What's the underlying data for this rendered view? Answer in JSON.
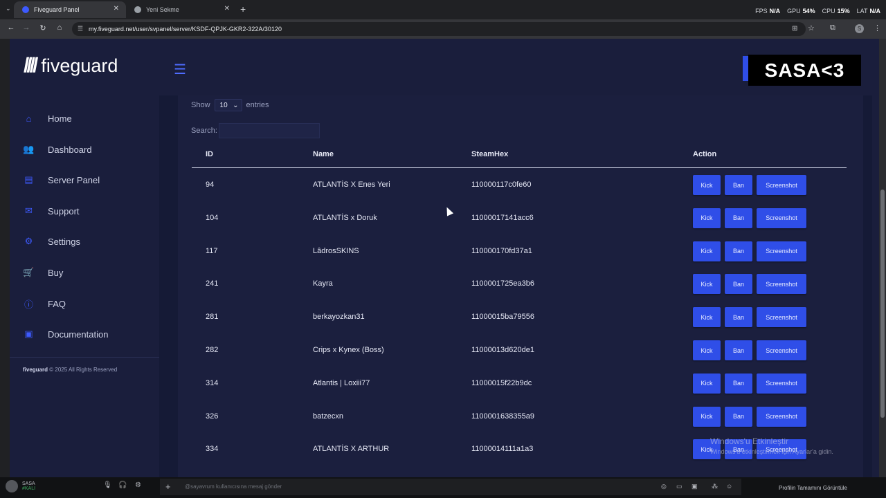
{
  "browser": {
    "tabs": [
      {
        "title": "Fiveguard Panel",
        "active": true
      },
      {
        "title": "Yeni Sekme",
        "active": false
      }
    ],
    "url": "my.fiveguard.net/user/svpanel/server/KSDF-QPJK-GKR2-322A/30120",
    "perf": [
      {
        "label": "FPS",
        "value": "N/A"
      },
      {
        "label": "GPU",
        "value": "54%"
      },
      {
        "label": "CPU",
        "value": "15%"
      },
      {
        "label": "LAT",
        "value": "N/A"
      }
    ],
    "profile_initial": "S"
  },
  "brand": {
    "name": "fiveguard",
    "mark": "////"
  },
  "overlay_label": "SASA<3",
  "sidebar": {
    "items": [
      {
        "label": "Home",
        "icon": "home-icon",
        "glyph": "⌂"
      },
      {
        "label": "Dashboard",
        "icon": "users-icon",
        "glyph": "👥"
      },
      {
        "label": "Server Panel",
        "icon": "server-icon",
        "glyph": "▤"
      },
      {
        "label": "Support",
        "icon": "mail-icon",
        "glyph": "✉"
      },
      {
        "label": "Settings",
        "icon": "gear-icon",
        "glyph": "⚙"
      },
      {
        "label": "Buy",
        "icon": "cart-icon",
        "glyph": "🛒"
      },
      {
        "label": "FAQ",
        "icon": "info-icon",
        "glyph": "ⓘ"
      },
      {
        "label": "Documentation",
        "icon": "document-icon",
        "glyph": "▣"
      }
    ],
    "footer_brand": "fiveguard",
    "footer_text": "© 2025 All Rights Reserved"
  },
  "table_controls": {
    "show_label": "Show",
    "entries_value": "10",
    "entries_label": "entries",
    "search_label": "Search:"
  },
  "table": {
    "columns": [
      "ID",
      "Name",
      "SteamHex",
      "Action"
    ],
    "actions": {
      "kick": "Kick",
      "ban": "Ban",
      "screenshot": "Screenshot"
    },
    "rows": [
      {
        "id": "94",
        "name": "ATLANTİS X Enes Yeri",
        "hex": "110000117c0fe60"
      },
      {
        "id": "104",
        "name": "ATLANTİS x Doruk",
        "hex": "11000017141acc6"
      },
      {
        "id": "117",
        "name": "LâdrosSKINS",
        "hex": "110000170fd37a1"
      },
      {
        "id": "241",
        "name": "Kayra",
        "hex": "1100001725ea3b6"
      },
      {
        "id": "281",
        "name": "berkayozkan31",
        "hex": "11000015ba79556"
      },
      {
        "id": "282",
        "name": "Crips x Kynex (Boss)",
        "hex": "11000013d620de1"
      },
      {
        "id": "314",
        "name": "Atlantis | Loxiii77",
        "hex": "11000015f22b9dc"
      },
      {
        "id": "326",
        "name": "batzecxn",
        "hex": "1100001638355a9"
      },
      {
        "id": "334",
        "name": "ATLANTİS X ARTHUR",
        "hex": "11000014111a1a3"
      }
    ]
  },
  "watermark": {
    "title": "Windows'u Etkinleştir",
    "subtitle": "Windows'u etkinleştirmek için Ayarlar'a gidin."
  },
  "bottom": {
    "user_name": "SASA",
    "user_status": "#KALI",
    "message_placeholder": "@sayavrum kullanıcısına mesaj gönder",
    "full_view": "Profilin Tamamını Görüntüle"
  }
}
